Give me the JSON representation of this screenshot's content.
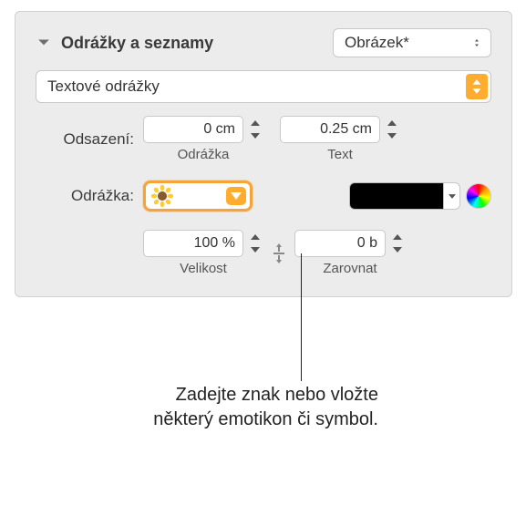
{
  "header": {
    "title": "Odrážky a seznamy",
    "style_popup": "Obrázek*"
  },
  "bullet_type_popup": "Textové odrážky",
  "indent": {
    "label": "Odsazení:",
    "bullet_value": "0 cm",
    "bullet_sublabel": "Odrážka",
    "text_value": "0.25 cm",
    "text_sublabel": "Text"
  },
  "bullet": {
    "label": "Odrážka:",
    "emoji": "🌻",
    "color": "#000000"
  },
  "size": {
    "value": "100 %",
    "sublabel": "Velikost"
  },
  "align": {
    "value": "0 b",
    "sublabel": "Zarovnat"
  },
  "callout": "Zadejte znak nebo vložte některý emotikon či symbol."
}
